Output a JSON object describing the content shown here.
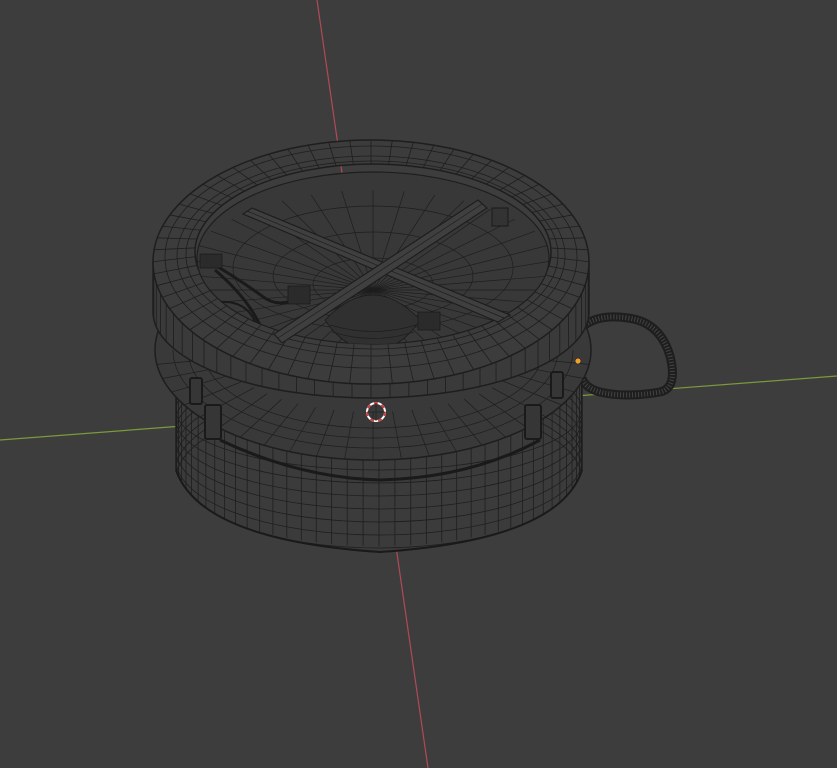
{
  "viewport": {
    "background_color": "#3d3d3d",
    "x_axis_color": "#7a9a3c",
    "y_axis_color": "#b04a55",
    "wire_color": "#1e1e1e",
    "mesh_fill_color": "#3b3b3b",
    "cursor_icon": "3d-cursor-icon",
    "origin_icon": "object-origin-icon",
    "origin_color": "#f0a028",
    "cursor_colors": [
      "#d04040",
      "#ffffff"
    ]
  }
}
